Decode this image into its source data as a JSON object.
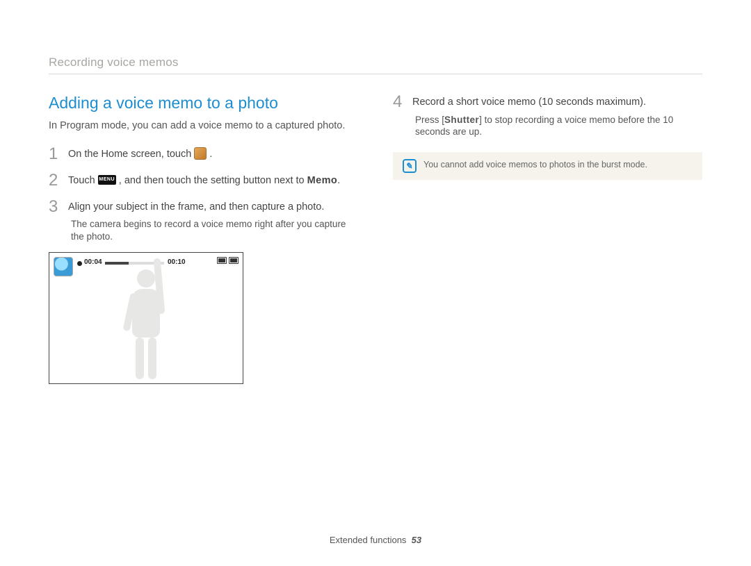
{
  "breadcrumb": "Recording voice memos",
  "section_title": "Adding a voice memo to a photo",
  "intro": "In Program mode, you can add a voice memo to a captured photo.",
  "steps": {
    "s1": {
      "num": "1",
      "text_a": "On the Home screen, touch ",
      "text_b": "."
    },
    "s2": {
      "num": "2",
      "text_a": "Touch ",
      "menu_label": "MENU",
      "text_b": " , and then touch the setting button next to ",
      "bold": "Memo",
      "text_c": "."
    },
    "s3": {
      "num": "3",
      "text": "Align your subject in the frame, and then capture a photo.",
      "note": "The camera begins to record a voice memo right after you capture the photo."
    },
    "s4": {
      "num": "4",
      "text": "Record a short voice memo (10 seconds maximum).",
      "note_a": "Press [",
      "note_bold": "Shutter",
      "note_b": "] to stop recording a voice memo before the 10 seconds are up."
    }
  },
  "camera": {
    "elapsed": "00:04",
    "total": "00:10"
  },
  "note_box": "You cannot add voice memos to photos in the burst mode.",
  "footer": {
    "section": "Extended functions",
    "page": "53"
  }
}
